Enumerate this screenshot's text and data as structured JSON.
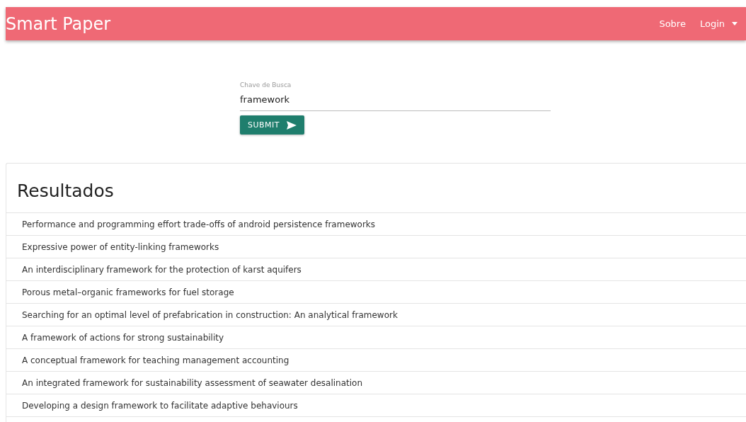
{
  "header": {
    "title": "Smart Paper",
    "nav": [
      "Sobre",
      "Login"
    ]
  },
  "search": {
    "label": "Chave de Busca",
    "value": "framework",
    "button": "SUBMIT"
  },
  "results": {
    "title": "Resultados",
    "items": [
      "Performance and programming effort trade-offs of android persistence frameworks",
      "Expressive power of entity-linking frameworks",
      "An interdisciplinary framework for the protection of karst aquifers",
      "Porous metal–organic frameworks for fuel storage",
      "Searching for an optimal level of prefabrication in construction: An analytical framework",
      "A framework of actions for strong sustainability",
      "A conceptual framework for teaching management accounting",
      "An integrated framework for sustainability assessment of seawater desalination",
      "Developing a design framework to facilitate adaptive behaviours"
    ]
  }
}
